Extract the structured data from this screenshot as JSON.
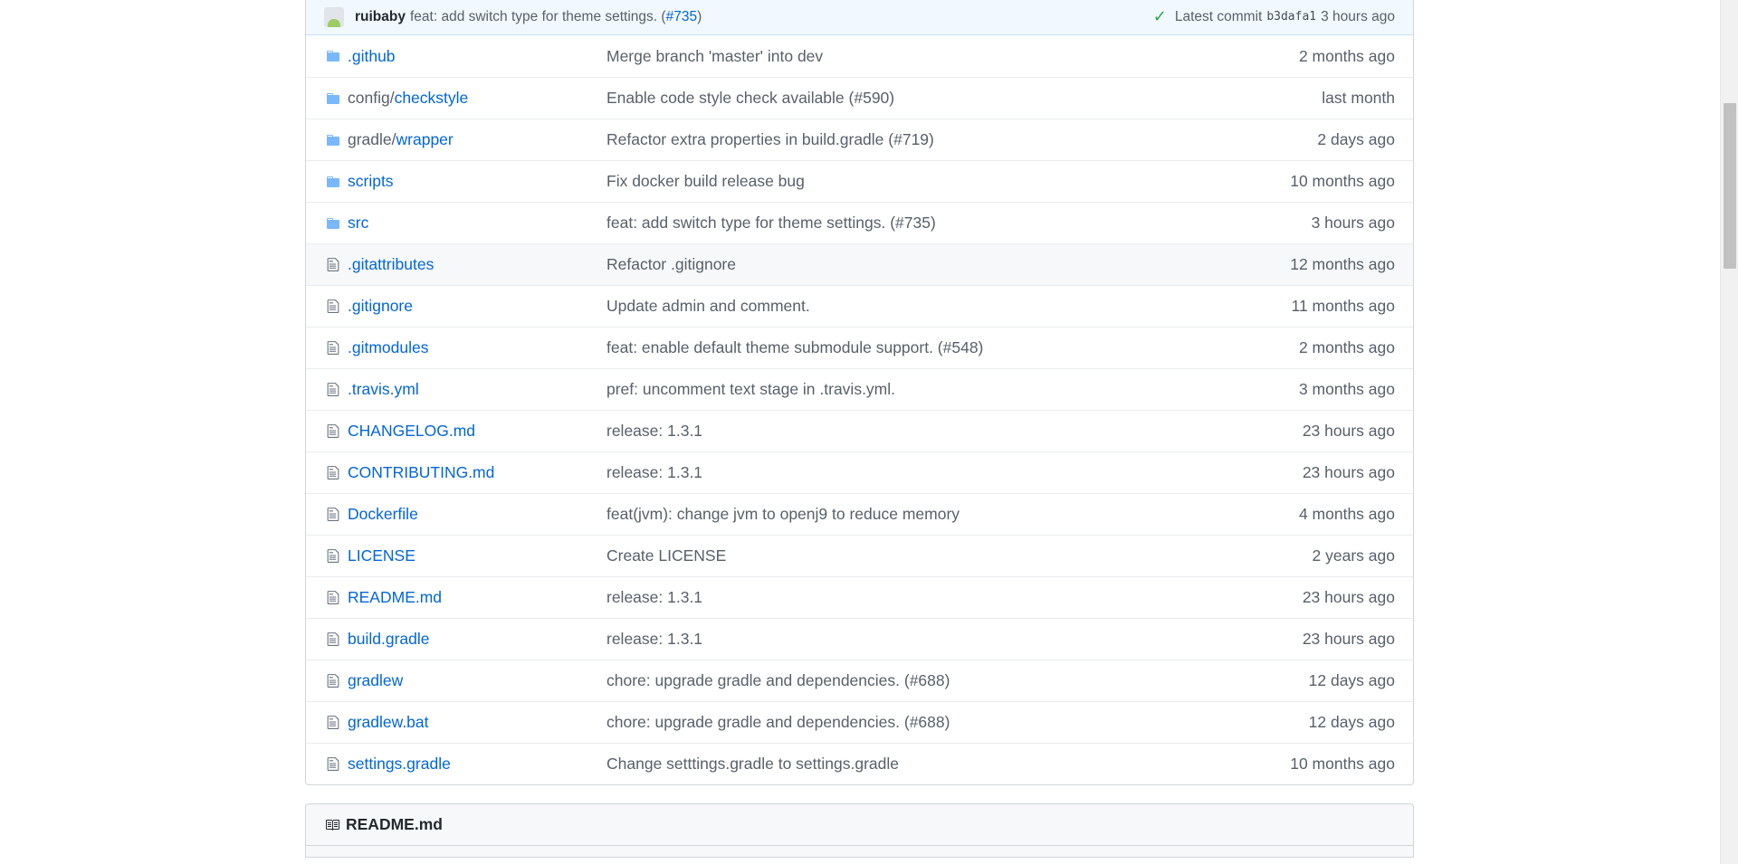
{
  "latest_commit": {
    "author": "ruibaby",
    "message": "feat: add switch type for theme settings. (",
    "pr_link": "#735",
    "message_end": ")",
    "label": "Latest commit",
    "sha": "b3dafa1",
    "time": "3 hours ago",
    "check_color": "#28a745"
  },
  "files": [
    {
      "type": "folder",
      "prefix": "",
      "name": ".github",
      "message": "Merge branch 'master' into dev",
      "age": "2 months ago"
    },
    {
      "type": "folder",
      "prefix": "config/",
      "name": "checkstyle",
      "message": "Enable code style check available (#590)",
      "age": "last month"
    },
    {
      "type": "folder",
      "prefix": "gradle/",
      "name": "wrapper",
      "message": "Refactor extra properties in build.gradle (#719)",
      "age": "2 days ago"
    },
    {
      "type": "folder",
      "prefix": "",
      "name": "scripts",
      "message": "Fix docker build release bug",
      "age": "10 months ago"
    },
    {
      "type": "folder",
      "prefix": "",
      "name": "src",
      "message": "feat: add switch type for theme settings. (#735)",
      "age": "3 hours ago"
    },
    {
      "type": "file",
      "prefix": "",
      "name": ".gitattributes",
      "message": "Refactor .gitignore",
      "age": "12 months ago"
    },
    {
      "type": "file",
      "prefix": "",
      "name": ".gitignore",
      "message": "Update admin and comment.",
      "age": "11 months ago"
    },
    {
      "type": "file",
      "prefix": "",
      "name": ".gitmodules",
      "message": "feat: enable default theme submodule support. (#548)",
      "age": "2 months ago"
    },
    {
      "type": "file",
      "prefix": "",
      "name": ".travis.yml",
      "message": "pref: uncomment text stage in .travis.yml.",
      "age": "3 months ago"
    },
    {
      "type": "file",
      "prefix": "",
      "name": "CHANGELOG.md",
      "message": "release: 1.3.1",
      "age": "23 hours ago"
    },
    {
      "type": "file",
      "prefix": "",
      "name": "CONTRIBUTING.md",
      "message": "release: 1.3.1",
      "age": "23 hours ago"
    },
    {
      "type": "file",
      "prefix": "",
      "name": "Dockerfile",
      "message": "feat(jvm): change jvm to openj9 to reduce memory",
      "age": "4 months ago"
    },
    {
      "type": "file",
      "prefix": "",
      "name": "LICENSE",
      "message": "Create LICENSE",
      "age": "2 years ago"
    },
    {
      "type": "file",
      "prefix": "",
      "name": "README.md",
      "message": "release: 1.3.1",
      "age": "23 hours ago"
    },
    {
      "type": "file",
      "prefix": "",
      "name": "build.gradle",
      "message": "release: 1.3.1",
      "age": "23 hours ago"
    },
    {
      "type": "file",
      "prefix": "",
      "name": "gradlew",
      "message": "chore: upgrade gradle and dependencies. (#688)",
      "age": "12 days ago"
    },
    {
      "type": "file",
      "prefix": "",
      "name": "gradlew.bat",
      "message": "chore: upgrade gradle and dependencies. (#688)",
      "age": "12 days ago"
    },
    {
      "type": "file",
      "prefix": "",
      "name": "settings.gradle",
      "message": "Change setttings.gradle to settings.gradle",
      "age": "10 months ago"
    }
  ],
  "readme": {
    "title": "README.md",
    "icon": "book-icon"
  },
  "colors": {
    "link": "#0366d6",
    "folder_icon": "#79b8ff",
    "muted": "#586069"
  }
}
